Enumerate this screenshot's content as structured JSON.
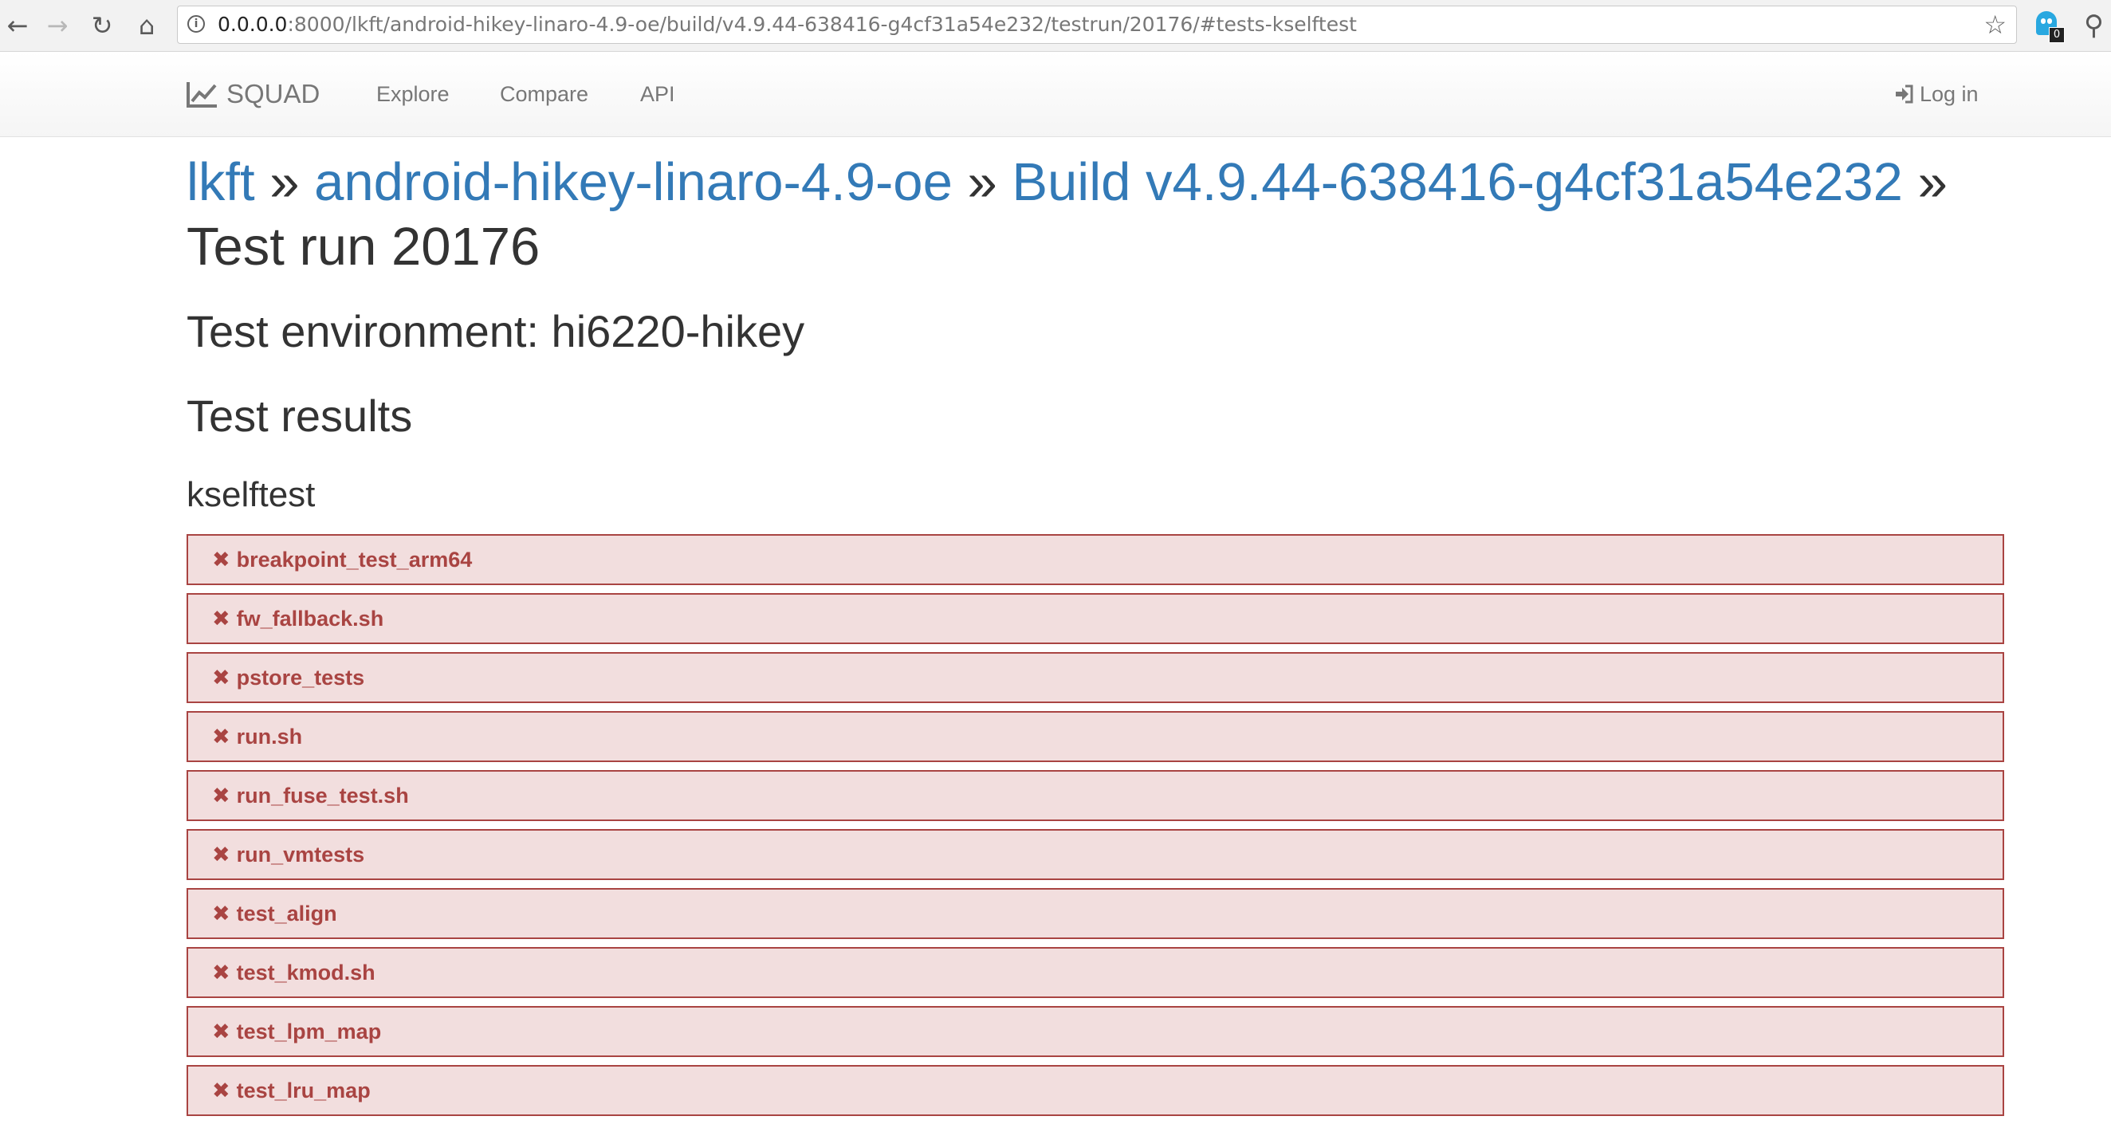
{
  "browser": {
    "back_icon": "arrow-left-icon",
    "forward_icon": "arrow-right-icon",
    "reload_icon": "reload-icon",
    "home_icon": "home-icon",
    "url_host": "0.0.0.0",
    "url_rest": ":8000/lkft/android-hikey-linaro-4.9-oe/build/v4.9.44-638416-g4cf31a54e232/testrun/20176/#tests-kselftest",
    "extension_badge": "0"
  },
  "navbar": {
    "brand": "SQUAD",
    "links": [
      "Explore",
      "Compare",
      "API"
    ],
    "login": "Log in"
  },
  "breadcrumb": {
    "project_group": "lkft",
    "separator": "»",
    "project": "android-hikey-linaro-4.9-oe",
    "build": "Build v4.9.44-638416-g4cf31a54e232",
    "current": "Test run 20176"
  },
  "environment_title": "Test environment: hi6220-hikey",
  "results_title": "Test results",
  "suite": {
    "name": "kselftest",
    "status_color": "#a94442",
    "tests": [
      "breakpoint_test_arm64",
      "fw_fallback.sh",
      "pstore_tests",
      "run.sh",
      "run_fuse_test.sh",
      "run_vmtests",
      "test_align",
      "test_kmod.sh",
      "test_lpm_map",
      "test_lru_map"
    ]
  },
  "colors": {
    "link": "#337ab7",
    "fail_bg": "#f2dede",
    "fail_text": "#a94442"
  }
}
